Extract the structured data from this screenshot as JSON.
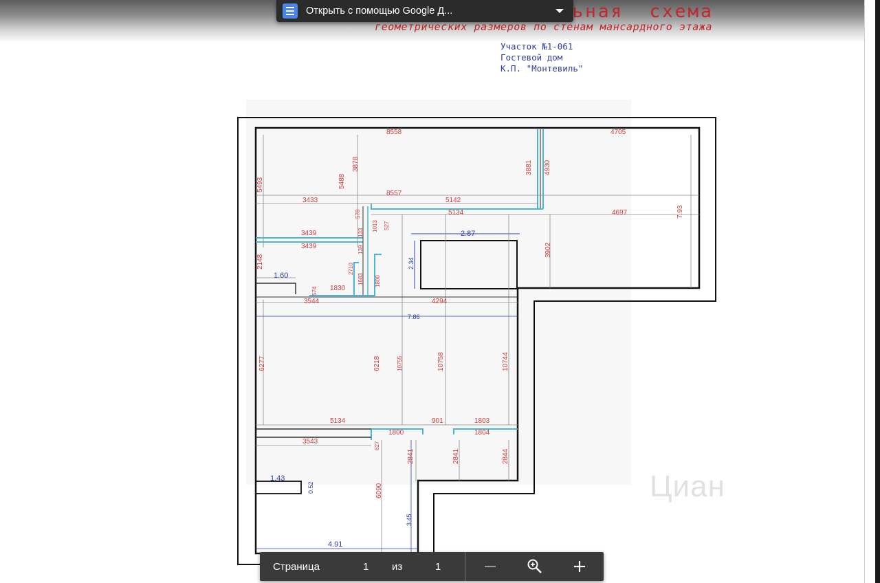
{
  "header": {
    "title_main": "Исполнительная  схема",
    "title_sub": "геометрических размеров по стенам мансардного этажа",
    "info_lines": [
      "Участок №1-061",
      "Гостевой дом",
      "К.П. \"Монтевиль\""
    ]
  },
  "open_with": {
    "label": "Открыть с помощью Google Д...",
    "icon": "google-docs-icon"
  },
  "plan": {
    "red_dims": [
      "8558",
      "4705",
      "3878",
      "3881",
      "4930",
      "5493",
      "5488",
      "8557",
      "5142",
      "3433",
      "5134",
      "4697",
      "7.93",
      "578",
      "133",
      "1013",
      "527",
      "3439",
      "3439",
      "139",
      "3902",
      "2148",
      "2710",
      "1683",
      "1830",
      "1800",
      "574",
      "3544",
      "4294",
      "6277",
      "6218",
      "10755",
      "10758",
      "10744",
      "5134",
      "901",
      "1803",
      "1800",
      "1804",
      "3543",
      "627",
      "2841",
      "2841",
      "2844",
      "6090"
    ],
    "blue_dims": [
      "2.87",
      "2.34",
      "1.60",
      "7.86",
      "1.43",
      "0.52",
      "3.45",
      "4.91"
    ]
  },
  "toolbar": {
    "page_label": "Страница",
    "current_page": "1",
    "of_label": "из",
    "total_pages": "1",
    "zoom_out_icon": "minus-icon",
    "zoom_reset_icon": "zoom-icon",
    "zoom_in_icon": "plus-icon"
  },
  "watermark": {
    "text": "Циан"
  },
  "colors": {
    "title_red": "#c0262a",
    "info_blue": "#2f3fa8",
    "dim_red": "#d23a3a",
    "dim_blue": "#2b3fb0",
    "wall_cyan": "#47b6d4",
    "toolbar_bg": "#3a3a3a",
    "docs_blue": "#4a86e8"
  }
}
